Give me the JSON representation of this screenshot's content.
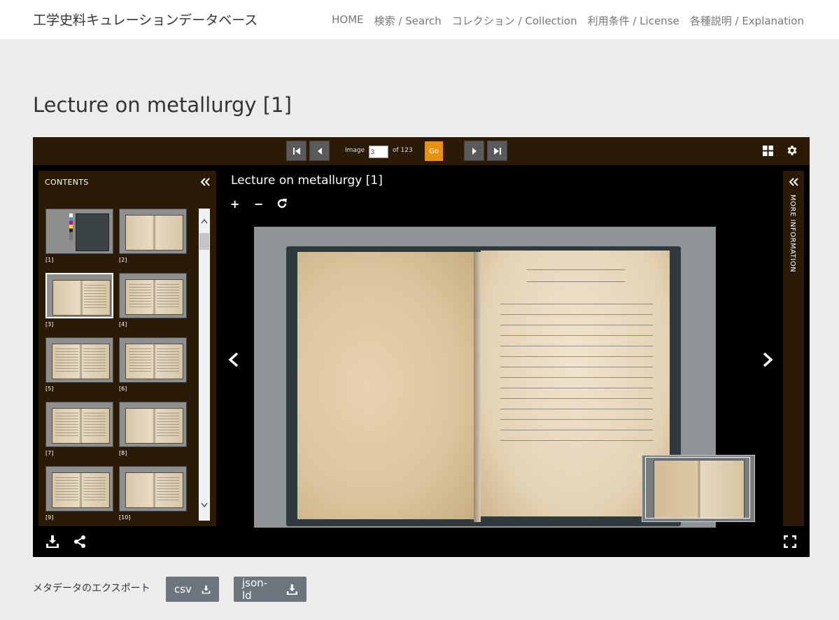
{
  "site": {
    "title": "工学史料キュレーションデータベース",
    "nav": [
      "HOME",
      "検索 / Search",
      "コレクション / Collection",
      "利用条件 / License",
      "各種説明 / Explanation"
    ]
  },
  "page_title": "Lecture on metallurgy [1]",
  "viewer": {
    "image_label": "Image",
    "current_page": "3",
    "of_label": "of 123",
    "go_label": "Go",
    "contents_title": "CONTENTS",
    "main_title": "Lecture on metallurgy [1]",
    "zoom_in": "+",
    "zoom_out": "−",
    "more_info": "MORE INFORMATION",
    "thumbnails": [
      "[1]",
      "[2]",
      "[3]",
      "[4]",
      "[5]",
      "[6]",
      "[7]",
      "[8]",
      "[9]",
      "[10]"
    ]
  },
  "export": {
    "label": "メタデータのエクスポート",
    "csv": "csv",
    "json": "json-ld"
  },
  "colors": {
    "toolbar": "#2b1a06",
    "go": "#e8920f",
    "export_button": "#6c757d"
  }
}
